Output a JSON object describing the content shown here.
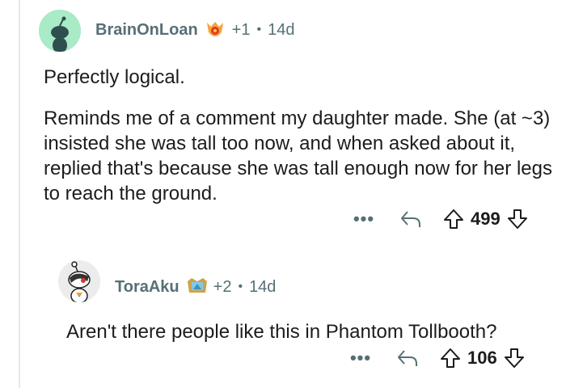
{
  "comments": [
    {
      "author": "BrainOnLoan",
      "flair_icon": "award-flair-icon",
      "award_count": "+1",
      "separator": "•",
      "age": "14d",
      "avatar_color": "#a9eac7",
      "paragraphs": [
        "Perfectly logical.",
        "Reminds me of a comment my daughter made. She (at ~3) insisted she was tall too now, and when asked about it, replied that's because she was tall enough now for her legs to reach the ground."
      ],
      "actions": {
        "more": "•••",
        "score": "499"
      }
    },
    {
      "author": "ToraAku",
      "flair_icon": "award-flair-icon",
      "award_count": "+2",
      "separator": "•",
      "age": "14d",
      "avatar_color": "#ececec",
      "paragraphs": [
        "Aren't there people like this in Phantom Tollbooth?"
      ],
      "actions": {
        "more": "•••",
        "score": "106"
      }
    }
  ],
  "colors": {
    "meta_text": "#576f76",
    "body_text": "#1c1c1c",
    "thread_line": "#e8e8e8"
  }
}
